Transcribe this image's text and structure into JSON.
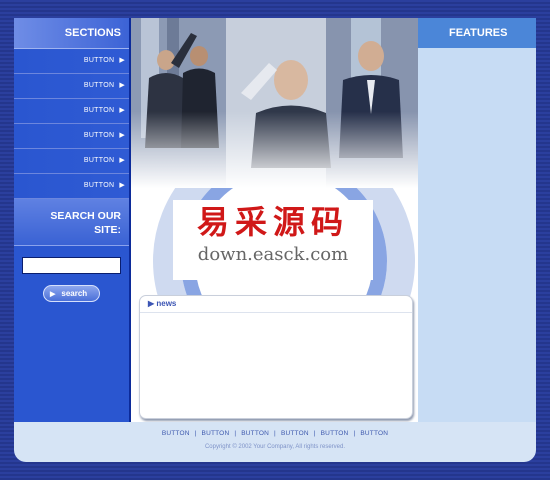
{
  "sidebar": {
    "title": "SECTIONS",
    "items": [
      {
        "label": "BUTTON"
      },
      {
        "label": "BUTTON"
      },
      {
        "label": "BUTTON"
      },
      {
        "label": "BUTTON"
      },
      {
        "label": "BUTTON"
      },
      {
        "label": "BUTTON"
      }
    ],
    "arrow_icon": "play-arrow-icon"
  },
  "search": {
    "title_line1": "SEARCH OUR",
    "title_line2": "SITE:",
    "input_value": "",
    "button_label": "search"
  },
  "watermark": {
    "chinese": "易采源码",
    "url": "down.easck.com"
  },
  "news": {
    "title": "news"
  },
  "right_panel": {
    "title": "FEATURES"
  },
  "footer": {
    "links": [
      "BUTTON",
      "BUTTON",
      "BUTTON",
      "BUTTON",
      "BUTTON",
      "BUTTON"
    ],
    "separator": "|",
    "copyright": "Copyright © 2002 Your Company, All rights reserved."
  },
  "colors": {
    "sidebar_bg": "#2a56d0",
    "features_head": "#4b86d8",
    "right_bg": "#c7dcf4",
    "watermark_red": "#d01818"
  }
}
